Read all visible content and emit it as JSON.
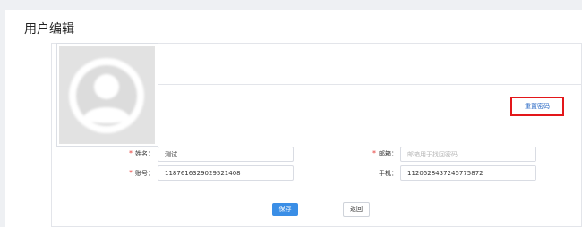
{
  "page": {
    "title": "用户编辑"
  },
  "avatar": {
    "icon": "default-user-avatar-icon"
  },
  "actions": {
    "reset_password_label": "重置密码",
    "save_label": "保存",
    "back_label": "返回"
  },
  "form": {
    "name": {
      "label": "姓名：",
      "required": "*",
      "value": "测试"
    },
    "email": {
      "label": "邮箱：",
      "required": "*",
      "value": "",
      "placeholder": "邮箱用于找回密码"
    },
    "account": {
      "label": "账号：",
      "required": "*",
      "value": "1187616329029521408"
    },
    "phone": {
      "label": "手机：",
      "value": "1120528437245775872"
    }
  },
  "colors": {
    "primary": "#3a8ee6",
    "highlight_border": "#e3171a",
    "required_mark": "#e53935",
    "page_bg": "#eef0f3"
  }
}
